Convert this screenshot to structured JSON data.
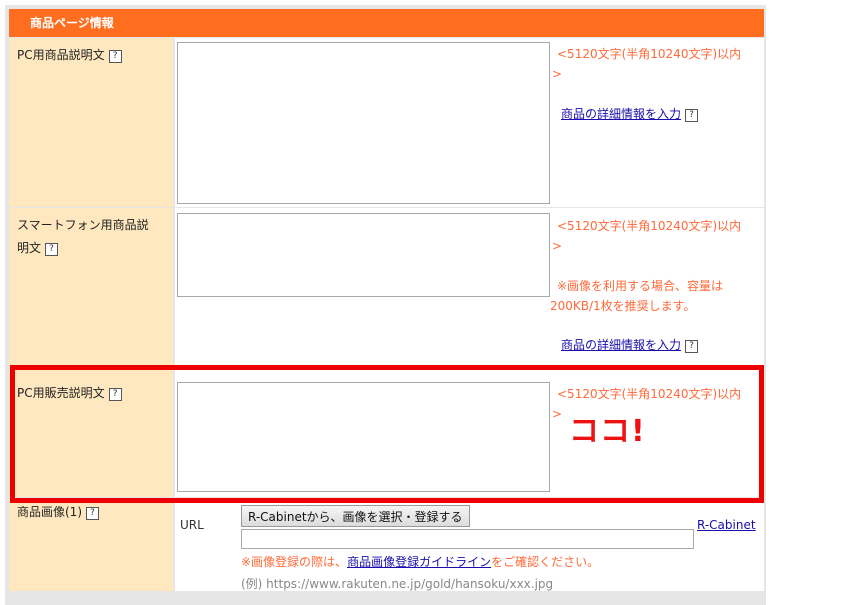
{
  "section": {
    "title": "商品ページ情報"
  },
  "rows": {
    "pc_desc": {
      "label": "PC用商品説明文",
      "limit_line1": "<5120文字(半角10240文字)以内",
      "limit_line2": ">",
      "detail_link": "商品の詳細情報を入力"
    },
    "sp_desc": {
      "label_line1": "スマートフォン用商品説",
      "label_line2": "明文",
      "limit_line1": "<5120文字(半角10240文字)以内",
      "limit_line2": ">",
      "image_note_line1": "※画像を利用する場合、容量は",
      "image_note_line2": "200KB/1枚を推奨します。",
      "detail_link": "商品の詳細情報を入力"
    },
    "pc_sales_desc": {
      "label": "PC用販売説明文",
      "limit_line1": "<5120文字(半角10240文字)以内",
      "limit_line2": ">"
    },
    "product_image": {
      "label": "商品画像(1)",
      "url_label": "URL",
      "button_label": "R-Cabinetから、画像を選択・登録する",
      "rcabinet_link": "R-Cabinet",
      "note_prefix": "※画像登録の際は、",
      "note_link": "商品画像登録ガイドライン",
      "note_suffix": "をご確認ください。",
      "example": "(例) https://www.rakuten.ne.jp/gold/hansoku/xxx.jpg"
    }
  },
  "annotation": {
    "text": "ココ!",
    "color": "#ee0000"
  },
  "help_icon_glyph": "?",
  "colors": {
    "header": "#ff6d1f",
    "label_bg": "#ffe8bf",
    "hint": "#ff6a3a",
    "link": "#1a0dab"
  }
}
